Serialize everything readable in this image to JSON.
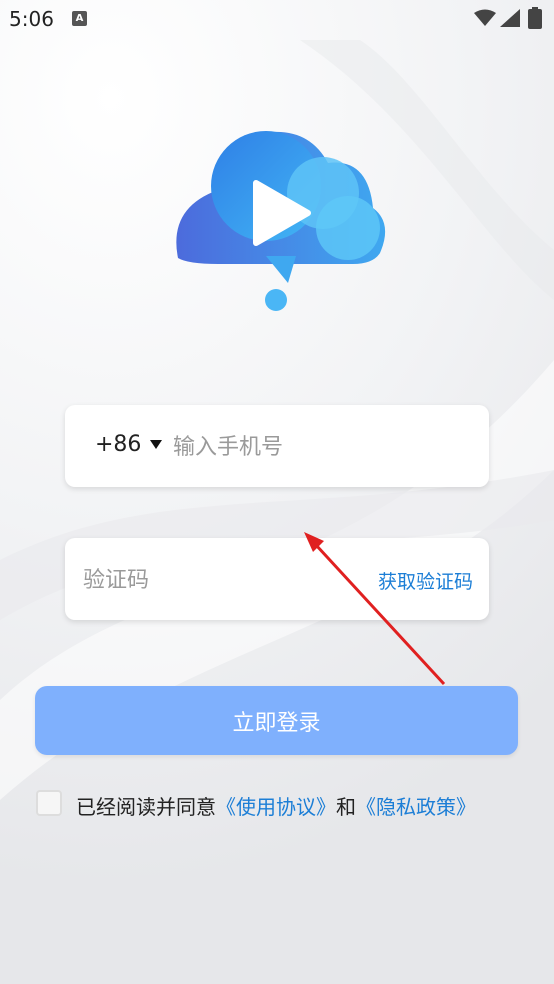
{
  "status_bar": {
    "time": "5:06",
    "notification_icon": "a-icon"
  },
  "logo": {
    "icon": "cloud-play-icon"
  },
  "phone": {
    "country_code": "+86",
    "placeholder": "输入手机号"
  },
  "code": {
    "placeholder": "验证码",
    "get_code_label": "获取验证码"
  },
  "login_button": {
    "label": "立即登录",
    "color": "#7fb0fd"
  },
  "agreement": {
    "prefix": "已经阅读并同意",
    "terms_link": "《使用协议》",
    "and": "和",
    "privacy_link": "《隐私政策》",
    "link_color": "#1c7ed6"
  },
  "annotation": {
    "arrow_color": "#e02020"
  }
}
